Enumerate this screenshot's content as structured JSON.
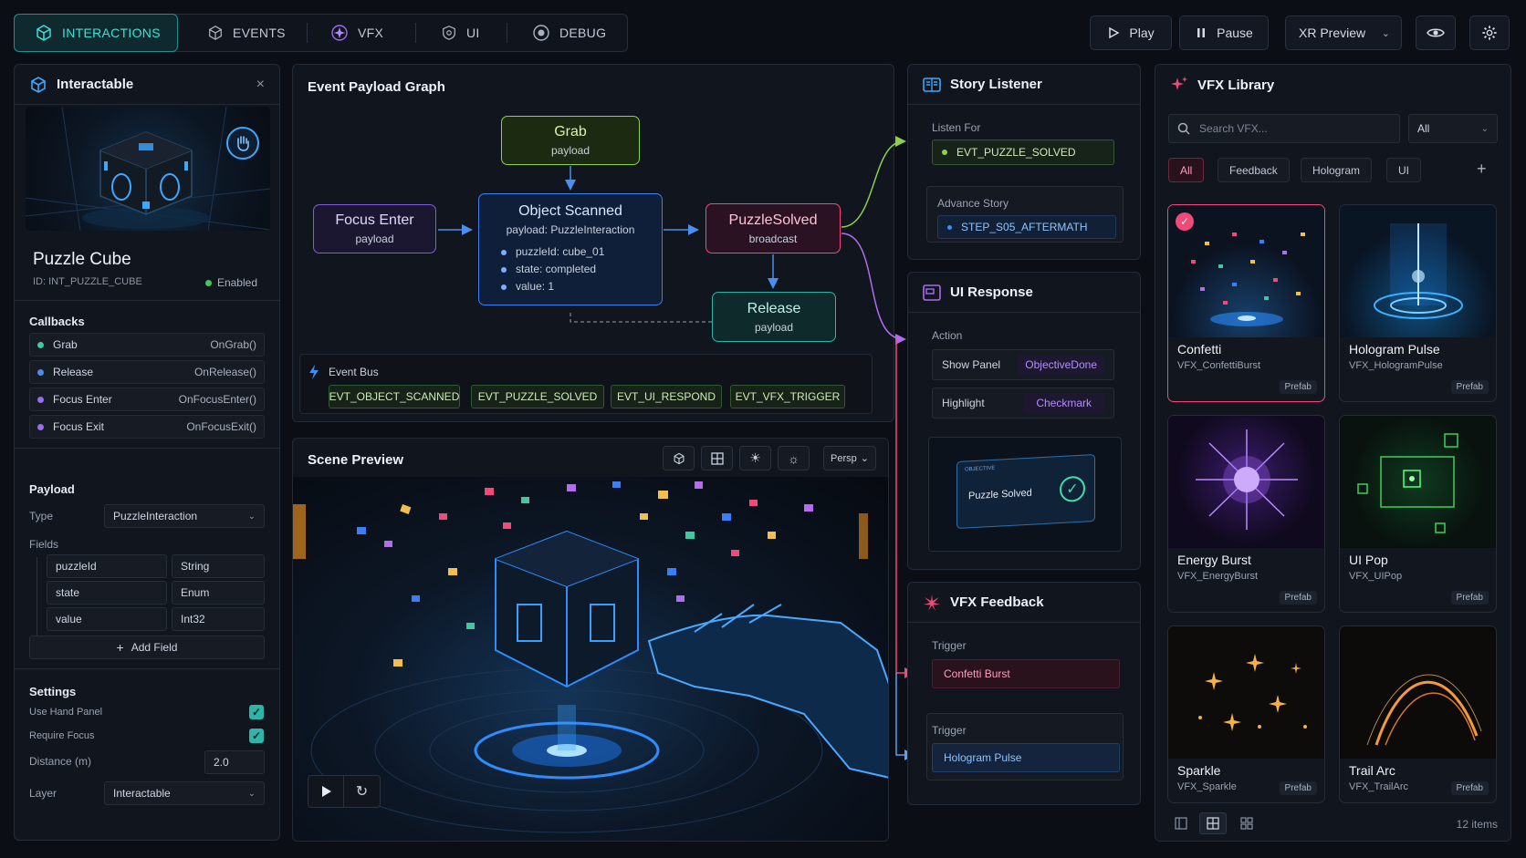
{
  "tabs": [
    {
      "label": "INTERACTIONS",
      "icon": "cube-icon"
    },
    {
      "label": "EVENTS",
      "icon": "box-icon"
    },
    {
      "label": "VFX",
      "icon": "sparkle-icon"
    },
    {
      "label": "UI",
      "icon": "shield-icon"
    },
    {
      "label": "DEBUG",
      "icon": "bug-icon"
    }
  ],
  "toolbar": {
    "play": "Play",
    "pause": "Pause",
    "preview": "XR Preview"
  },
  "interactable": {
    "title": "Interactable",
    "name": "Puzzle Cube",
    "id": "ID: INT_PUZZLE_CUBE",
    "status": "Enabled",
    "callbacks_title": "Callbacks",
    "callbacks": [
      {
        "label": "Grab",
        "fn": "OnGrab()",
        "color": "#3ec9a0"
      },
      {
        "label": "Release",
        "fn": "OnRelease()",
        "color": "#4a8ff0"
      },
      {
        "label": "Focus Enter",
        "fn": "OnFocusEnter()",
        "color": "#9a6cf0"
      },
      {
        "label": "Focus Exit",
        "fn": "OnFocusExit()",
        "color": "#9a6cf0"
      }
    ],
    "payload_title": "Payload",
    "type_label": "Type",
    "type_value": "PuzzleInteraction",
    "fields_label": "Fields",
    "fields": [
      {
        "name": "puzzleId",
        "type": "String"
      },
      {
        "name": "state",
        "type": "Enum"
      },
      {
        "name": "value",
        "type": "Int32"
      }
    ],
    "add_field": "Add Field",
    "settings_title": "Settings",
    "use_hand_panel": "Use Hand Panel",
    "require_focus": "Require Focus",
    "distance_label": "Distance (m)",
    "distance_value": "2.0",
    "layer_label": "Layer",
    "layer_value": "Interactable"
  },
  "graph": {
    "title": "Event Payload Graph",
    "grab": {
      "title": "Grab",
      "sub": "payload"
    },
    "focus": {
      "title": "Focus Enter",
      "sub": "payload"
    },
    "scanned": {
      "title": "Object Scanned",
      "sub": "payload: PuzzleInteraction",
      "items": [
        "puzzleId: cube_01",
        "state: completed",
        "value: 1"
      ]
    },
    "solved": {
      "title": "PuzzleSolved",
      "sub": "broadcast"
    },
    "release": {
      "title": "Release",
      "sub": "payload"
    },
    "bus_title": "Event Bus",
    "bus": [
      "EVT_OBJECT_SCANNED",
      "EVT_PUZZLE_SOLVED",
      "EVT_UI_RESPOND",
      "EVT_VFX_TRIGGER"
    ]
  },
  "scene": {
    "title": "Scene Preview",
    "persp": "Persp"
  },
  "story": {
    "title": "Story Listener",
    "listen_label": "Listen For",
    "listen_value": "EVT_PUZZLE_SOLVED",
    "advance_label": "Advance Story",
    "advance_value": "STEP_S05_AFTERMATH"
  },
  "ui_response": {
    "title": "UI Response",
    "action_label": "Action",
    "actions": [
      {
        "label": "Show Panel",
        "value": "ObjectiveDone"
      },
      {
        "label": "Highlight",
        "value": "Checkmark"
      }
    ],
    "preview_small": "OBJECTIVE",
    "preview_text": "Puzzle Solved"
  },
  "vfx_feedback": {
    "title": "VFX Feedback",
    "trigger1_label": "Trigger",
    "trigger1_value": "Confetti Burst",
    "trigger2_label": "Trigger",
    "trigger2_value": "Hologram Pulse"
  },
  "vfx_library": {
    "title": "VFX Library",
    "search_placeholder": "Search VFX...",
    "filter_value": "All",
    "chips": [
      "All",
      "Feedback",
      "Hologram",
      "UI"
    ],
    "items": [
      {
        "name": "Confetti",
        "code": "VFX_ConfettiBurst",
        "tag": "Prefab"
      },
      {
        "name": "Hologram Pulse",
        "code": "VFX_HologramPulse",
        "tag": "Prefab"
      },
      {
        "name": "Energy Burst",
        "code": "VFX_EnergyBurst",
        "tag": "Prefab"
      },
      {
        "name": "UI Pop",
        "code": "VFX_UIPop",
        "tag": "Prefab"
      },
      {
        "name": "Sparkle",
        "code": "VFX_Sparkle",
        "tag": "Prefab"
      },
      {
        "name": "Trail Arc",
        "code": "VFX_TrailArc",
        "tag": "Prefab"
      }
    ],
    "count": "12 items"
  },
  "colors": {
    "accent": "#1fd0c8",
    "pink": "#f04a78",
    "blue": "#3b7ff5",
    "green": "#8bd24a"
  }
}
